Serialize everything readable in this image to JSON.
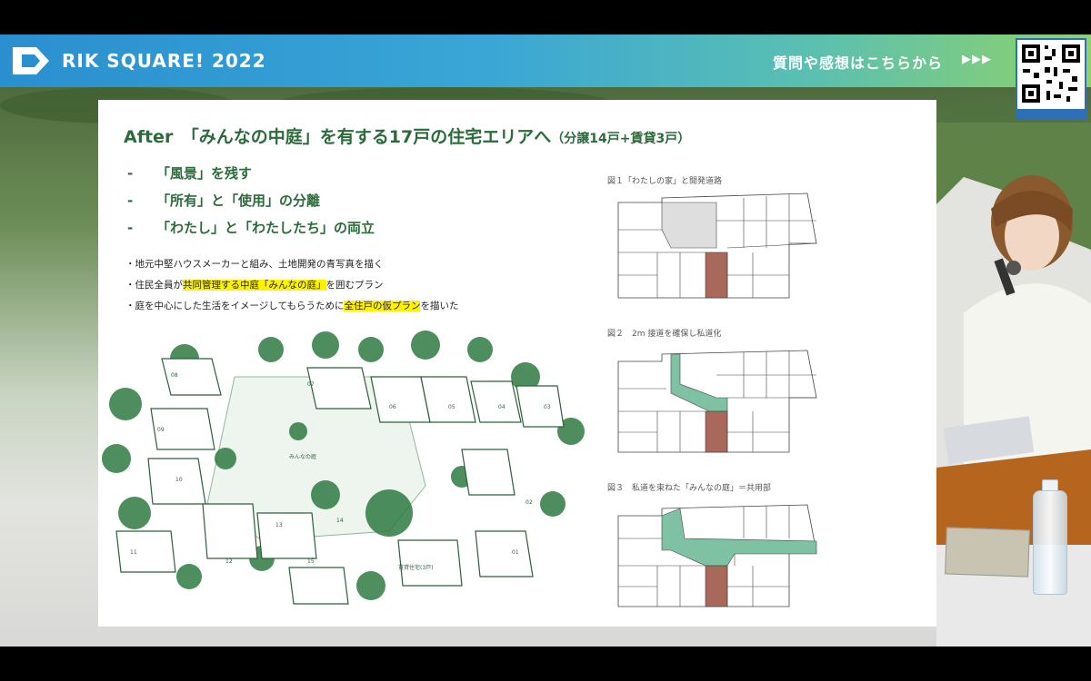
{
  "header": {
    "brand": "RIK SQUARE! 2022",
    "qa_text": "質問や感想はこちらから",
    "qa_arrows": "▶▶▶",
    "qr_icon": "qr-code-icon"
  },
  "slide": {
    "title_main": "After　「みんなの中庭」を有する17戸の住宅エリアへ",
    "title_sub": "（分譲14戸+賃貸3戸）",
    "bullets": [
      {
        "dash": "-",
        "text": "「風景」を残す"
      },
      {
        "dash": "-",
        "text": "「所有」と「使用」の分離"
      },
      {
        "dash": "-",
        "text": "「わたし」と「わたしたち」の両立"
      }
    ],
    "notes": [
      {
        "pre": "・地元中堅ハウスメーカーと組み、土地開発の青写真を描く",
        "hl": "",
        "post": ""
      },
      {
        "pre": "・住民全員が",
        "hl": "共同管理する中庭「みんなの庭」",
        "post": "を囲むプラン"
      },
      {
        "pre": "・庭を中心にした生活をイメージしてもらうために",
        "hl": "全住戸の仮プラン",
        "post": "を描いた"
      }
    ],
    "figures": [
      {
        "caption": "図１「わたしの家」と開発道路"
      },
      {
        "caption": "図２　2m 接道を確保し私道化"
      },
      {
        "caption": "図３　私道を束ねた「みんなの庭」＝共用部"
      }
    ],
    "illustration": {
      "unit_numbers": [
        "08",
        "09",
        "10",
        "11",
        "12",
        "13",
        "14",
        "15",
        "06",
        "05",
        "04",
        "03",
        "02",
        "01",
        "07"
      ],
      "courtyard_label": "みんなの庭",
      "rental_label": "賃貸住宅(3戸)"
    }
  },
  "colors": {
    "title_green": "#2b6b3a",
    "highlight": "#fff200",
    "road_brown": "#a8685a",
    "shared_green": "#7fc2a3",
    "road_gray": "#d9d9d9"
  }
}
